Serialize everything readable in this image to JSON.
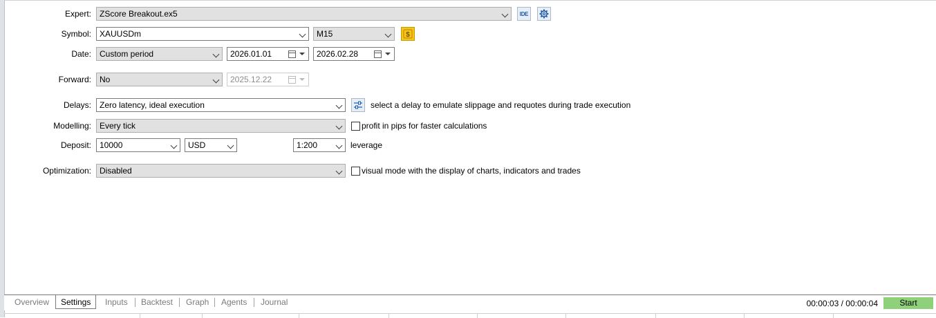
{
  "form": {
    "expert": {
      "label": "Expert:",
      "value": "ZScore Breakout.ex5"
    },
    "expert_ide_button": "IDE",
    "symbol": {
      "label": "Symbol:",
      "value": "XAUUSDm",
      "timeframe": "M15"
    },
    "date": {
      "label": "Date:",
      "period": "Custom period",
      "from": "2026.01.01",
      "to": "2026.02.28"
    },
    "forward": {
      "label": "Forward:",
      "value": "No",
      "date": "2025.12.22"
    },
    "delays": {
      "label": "Delays:",
      "value": "Zero latency, ideal execution",
      "hint": "select a delay to emulate slippage and requotes during trade execution"
    },
    "modelling": {
      "label": "Modelling:",
      "value": "Every tick",
      "checkbox_label": "profit in pips for faster calculations"
    },
    "deposit": {
      "label": "Deposit:",
      "amount": "10000",
      "currency": "USD",
      "leverage": "1:200",
      "leverage_label": "leverage"
    },
    "optimization": {
      "label": "Optimization:",
      "value": "Disabled",
      "checkbox_label": "visual mode with the display of charts, indicators and trades"
    }
  },
  "tabs": [
    "Overview",
    "Settings",
    "Inputs",
    "Backtest",
    "Graph",
    "Agents",
    "Journal"
  ],
  "active_tab": "Settings",
  "timer": "00:00:03 / 00:00:04",
  "start_label": "Start",
  "colors": {
    "start_button": "#8fd17a",
    "symbol_icon": "#f5c518",
    "icon_blue": "#1e5aa8"
  },
  "icons": [
    "gear-icon",
    "dollar-icon",
    "delay-settings-icon",
    "calendar-icon"
  ]
}
